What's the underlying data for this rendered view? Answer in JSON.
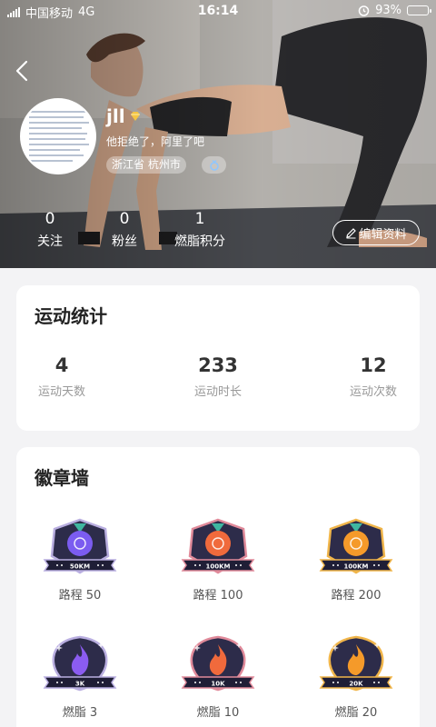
{
  "status_bar": {
    "carrier": "中国移动",
    "network": "4G",
    "time": "16:14",
    "battery": "93%",
    "battery_level": 0.93
  },
  "profile": {
    "username": "jll",
    "bio": "他拒绝了，阿里了吧",
    "location": "浙江省 杭州市",
    "stats": [
      {
        "value": "0",
        "label": "关注"
      },
      {
        "value": "0",
        "label": "粉丝"
      },
      {
        "value": "1",
        "label": "燃脂积分"
      }
    ],
    "edit_label": "编辑资料"
  },
  "exercise_stats": {
    "title": "运动统计",
    "items": [
      {
        "value": "4",
        "label": "运动天数"
      },
      {
        "value": "233",
        "label": "运动时长"
      },
      {
        "value": "12",
        "label": "运动次数"
      }
    ]
  },
  "badge_wall": {
    "title": "徽章墙",
    "badges": [
      {
        "label": "路程 50",
        "ribbon": "50KM",
        "kind": "medal",
        "color": "#7b5cf0",
        "rim": "#b9aee0"
      },
      {
        "label": "路程 100",
        "ribbon": "100KM",
        "kind": "medal",
        "color": "#f06a3c",
        "rim": "#e08a9a"
      },
      {
        "label": "路程 200",
        "ribbon": "100KM",
        "kind": "medal",
        "color": "#f59a2a",
        "rim": "#f0b54a"
      },
      {
        "label": "燃脂 3",
        "ribbon": "3K",
        "kind": "flame",
        "color": "#8b5cf0",
        "rim": "#b9aee0"
      },
      {
        "label": "燃脂 10",
        "ribbon": "10K",
        "kind": "flame",
        "color": "#f06a3c",
        "rim": "#e08a9a"
      },
      {
        "label": "燃脂 20",
        "ribbon": "20K",
        "kind": "flame",
        "color": "#f59a2a",
        "rim": "#f0b54a"
      }
    ]
  },
  "icons": {
    "back": "chevron-left-icon",
    "vip": "diamond-icon",
    "gender": "female-icon",
    "edit": "pencil-icon",
    "alarm": "alarm-icon"
  }
}
